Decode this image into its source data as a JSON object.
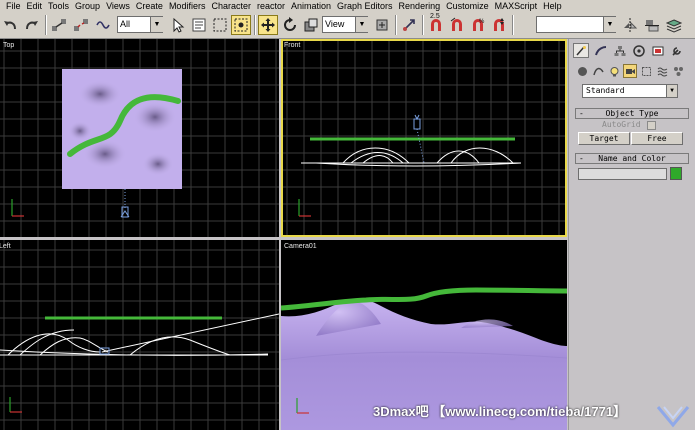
{
  "menu": [
    "File",
    "Edit",
    "Tools",
    "Group",
    "Views",
    "Create",
    "Modifiers",
    "Character",
    "reactor",
    "Animation",
    "Graph Editors",
    "Rendering",
    "Customize",
    "MAXScript",
    "Help"
  ],
  "toolbar": {
    "selection_filter": "All",
    "reference_coord": "View",
    "snap_value": "2.5",
    "named_selection": "",
    "icons": [
      "undo-icon",
      "redo-icon",
      "select-link-icon",
      "unlink-icon",
      "bind-space-warp-icon",
      "select-object-icon",
      "select-by-name-icon",
      "rectangular-region-icon",
      "window-crossing-icon",
      "select-move-icon",
      "select-rotate-icon",
      "select-scale-icon",
      "pivot-center-icon",
      "select-manipulate-icon",
      "snap-toggle-icon",
      "angle-snap-icon",
      "percent-snap-icon",
      "spinner-snap-icon",
      "mirror-icon",
      "align-icon",
      "layer-manager-icon"
    ]
  },
  "viewports": {
    "top": {
      "label": "Top"
    },
    "front": {
      "label": "Front"
    },
    "left": {
      "label": "Left"
    },
    "camera": {
      "label": "Camera01"
    }
  },
  "command_panel": {
    "tabs": [
      "create-tab",
      "modify-tab",
      "hierarchy-tab",
      "motion-tab",
      "display-tab",
      "utilities-tab"
    ],
    "active_tab": "create-tab",
    "subtabs": [
      "geometry-icon",
      "shapes-icon",
      "lights-icon",
      "cameras-icon",
      "helpers-icon",
      "space-warps-icon",
      "systems-icon"
    ],
    "active_subtab": "cameras-icon",
    "category": "Standard",
    "object_type": {
      "title": "Object Type",
      "autogrid": "AutoGrid",
      "buttons": [
        "Target",
        "Free"
      ]
    },
    "name_color": {
      "title": "Name and Color",
      "name_value": "",
      "color": "#2fa92a"
    }
  },
  "colors": {
    "viewport_bg": "#000000",
    "grid": "#3a3a3a",
    "terrain": "#b6a0e8",
    "path": "#45b83a",
    "active_border": "#e8d84a"
  },
  "watermark": "3Dmax吧 【www.linecg.com/tieba/1771】"
}
